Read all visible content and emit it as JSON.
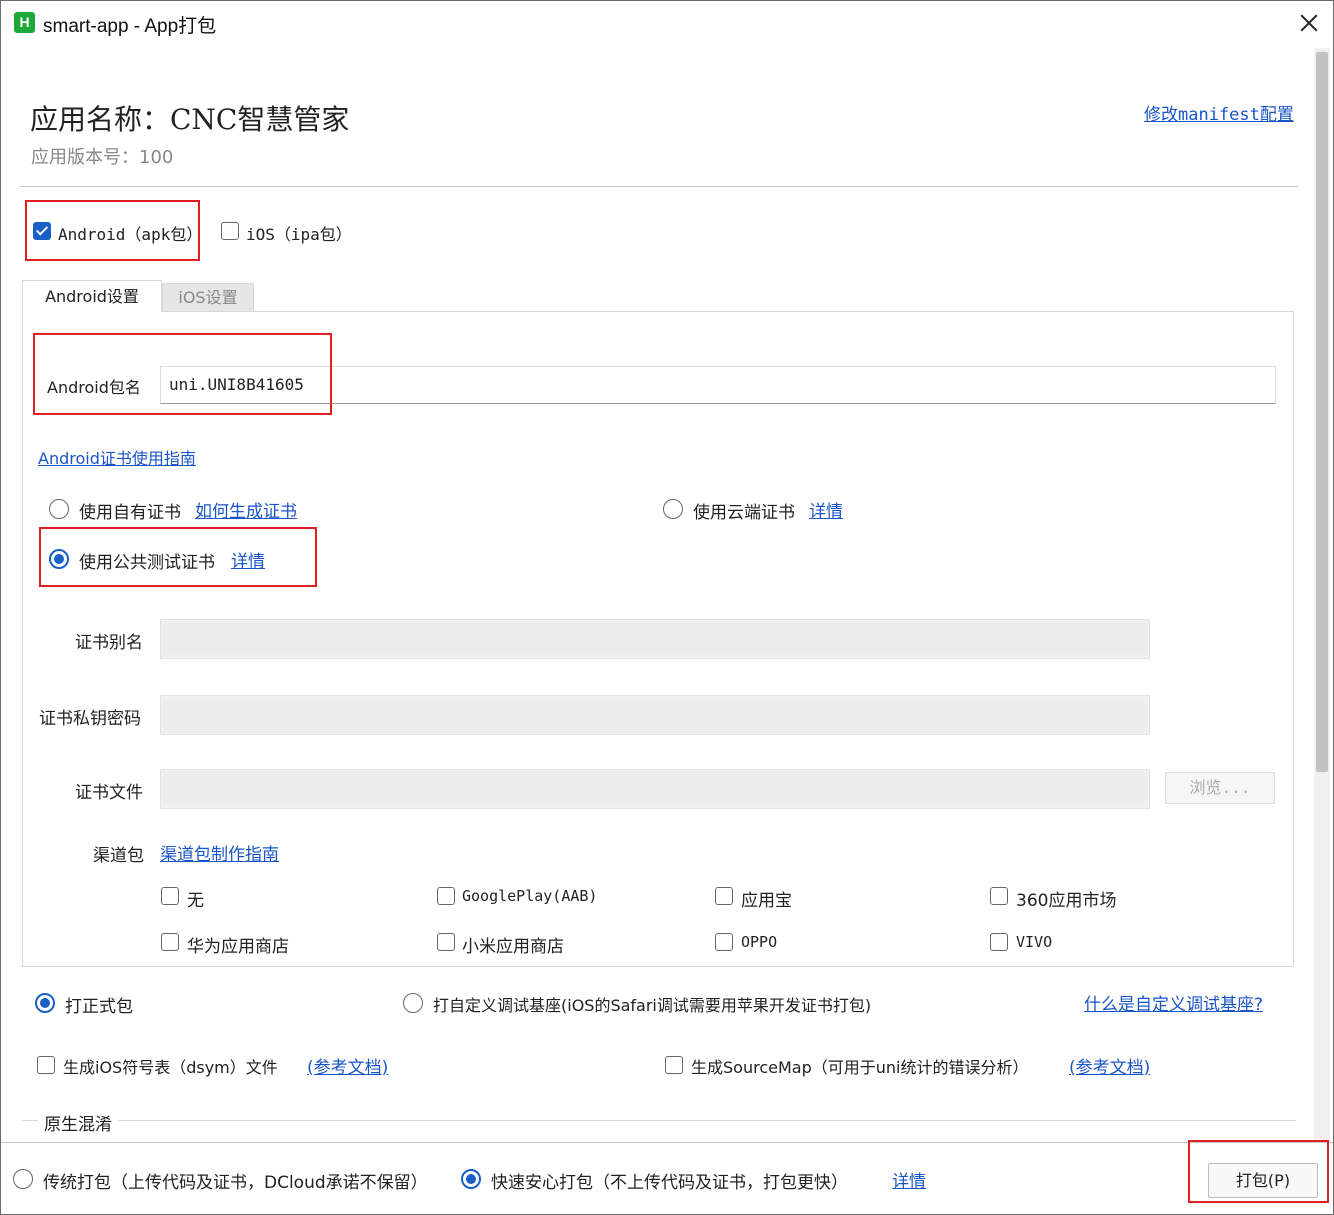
{
  "window": {
    "title": "smart-app - App打包",
    "icon_letter": "H"
  },
  "header": {
    "app_name": "应用名称：CNC智慧管家",
    "app_version": "应用版本号：100",
    "manifest_link": "修改manifest配置"
  },
  "platforms": {
    "android": {
      "label": "Android（apk包）",
      "checked": true
    },
    "ios": {
      "label": "iOS（ipa包）",
      "checked": false
    }
  },
  "tabs": [
    {
      "label": "Android设置",
      "active": true
    },
    {
      "label": "iOS设置",
      "active": false
    }
  ],
  "android": {
    "package_label": "Android包名",
    "package_value": "uni.UNI8B41605",
    "cert_guide_link": "Android证书使用指南",
    "cert_options": {
      "own": {
        "label": "使用自有证书",
        "link": "如何生成证书",
        "checked": false
      },
      "cloud": {
        "label": "使用云端证书",
        "link": "详情",
        "checked": false
      },
      "public_test": {
        "label": "使用公共测试证书",
        "link": "详情",
        "checked": true
      }
    },
    "cert_alias_label": "证书别名",
    "cert_password_label": "证书私钥密码",
    "cert_file_label": "证书文件",
    "browse_button": "浏览...",
    "channel_label": "渠道包",
    "channel_guide_link": "渠道包制作指南",
    "channels": [
      {
        "label": "无",
        "checked": false
      },
      {
        "label": "GooglePlay(AAB)",
        "checked": false
      },
      {
        "label": "应用宝",
        "checked": false
      },
      {
        "label": "360应用市场",
        "checked": false
      },
      {
        "label": "华为应用商店",
        "checked": false
      },
      {
        "label": "小米应用商店",
        "checked": false
      },
      {
        "label": "OPPO",
        "checked": false
      },
      {
        "label": "VIVO",
        "checked": false
      }
    ]
  },
  "build_type": {
    "release": {
      "label": "打正式包",
      "checked": true
    },
    "custom_base": {
      "label": "打自定义调试基座(iOS的Safari调试需要用苹果开发证书打包)",
      "checked": false
    },
    "custom_base_help": "什么是自定义调试基座?"
  },
  "extras": {
    "dsym": {
      "label": "生成iOS符号表（dsym）文件",
      "link": "(参考文档)",
      "checked": false
    },
    "sourcemap": {
      "label": "生成SourceMap（可用于uni统计的错误分析）",
      "link": "(参考文档)",
      "checked": false
    }
  },
  "obfuscation_section": "原生混淆",
  "footer": {
    "traditional": {
      "label": "传统打包（上传代码及证书，DCloud承诺不保留）",
      "checked": false
    },
    "fast": {
      "label": "快速安心打包（不上传代码及证书，打包更快）",
      "checked": true
    },
    "details_link": "详情",
    "pack_button": "打包(P)"
  },
  "accent_color": "#1a5fc7",
  "highlight_color": "#e02020"
}
